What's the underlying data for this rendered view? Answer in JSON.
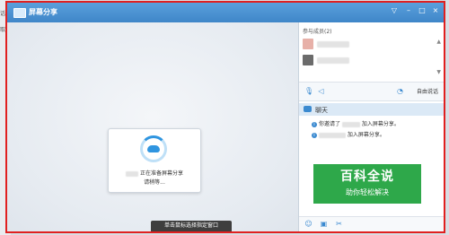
{
  "behind": {
    "text1": "话/",
    "text2": "取"
  },
  "window": {
    "title": "屏幕分享",
    "buttons": {
      "pin": "▽",
      "minimize": "–",
      "maximize": "□",
      "close": "×"
    }
  },
  "stage": {
    "status_line1": "正在准备屏幕分享",
    "status_line2": "请稍等...",
    "tooltip": "单击鼠标选择指定窗口"
  },
  "panel": {
    "members_title": "参与成员(2)",
    "free_talk_label": "自由说话",
    "chat_label": "聊天",
    "chat_messages": [
      {
        "prefix": "你邀请了",
        "suffix": "加入屏幕分享。"
      },
      {
        "prefix": "",
        "suffix": "加入屏幕分享。"
      }
    ],
    "watermark": {
      "line1": "百科全说",
      "line2": "助你轻松解决"
    }
  },
  "colors": {
    "titlebar": "#4a93d3",
    "highlight_border": "#e02020",
    "accent": "#2f95e0",
    "watermark_bg": "#2ea84a"
  }
}
